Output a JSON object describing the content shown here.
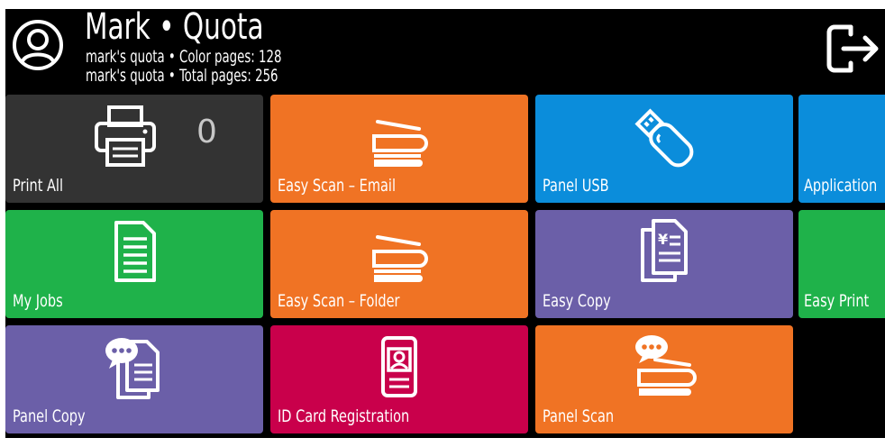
{
  "header": {
    "title": "Mark • Quota",
    "quota_line_1": "mark's quota • Color pages: 128",
    "quota_line_2": "mark's quota • Total pages: 256"
  },
  "tiles": [
    {
      "label": "Print All",
      "color": "#333333",
      "icon": "printer-icon",
      "count": "0"
    },
    {
      "label": "Easy Scan – Email",
      "color": "#f07324",
      "icon": "scanner-icon"
    },
    {
      "label": "Panel USB",
      "color": "#0b8ddb",
      "icon": "usb-drive-icon"
    },
    {
      "label": "Application",
      "color": "#0b8ddb",
      "icon": ""
    },
    {
      "label": "My Jobs",
      "color": "#1fb24a",
      "icon": "document-icon"
    },
    {
      "label": "Easy Scan – Folder",
      "color": "#f07324",
      "icon": "scanner-icon"
    },
    {
      "label": "Easy Copy",
      "color": "#6b5fa8",
      "icon": "copy-documents-icon"
    },
    {
      "label": "Easy Print",
      "color": "#1fb24a",
      "icon": ""
    },
    {
      "label": "Panel Copy",
      "color": "#6b5fa8",
      "icon": "copy-chat-icon"
    },
    {
      "label": "ID Card Registration",
      "color": "#c9004b",
      "icon": "id-badge-icon"
    },
    {
      "label": "Panel Scan",
      "color": "#f07324",
      "icon": "scanner-chat-icon"
    }
  ]
}
